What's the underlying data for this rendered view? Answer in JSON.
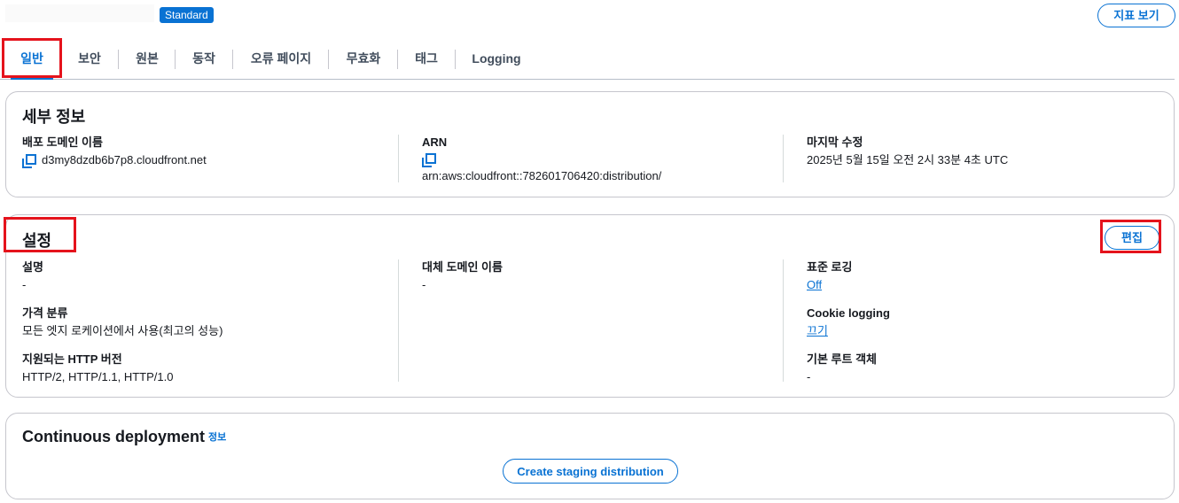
{
  "header": {
    "badge": "Standard",
    "metrics_button": "지표 보기"
  },
  "tabs": [
    {
      "label": "일반",
      "active": true
    },
    {
      "label": "보안",
      "active": false
    },
    {
      "label": "원본",
      "active": false
    },
    {
      "label": "동작",
      "active": false
    },
    {
      "label": "오류 페이지",
      "active": false
    },
    {
      "label": "무효화",
      "active": false
    },
    {
      "label": "태그",
      "active": false
    },
    {
      "label": "Logging",
      "active": false
    }
  ],
  "details": {
    "title": "세부 정보",
    "domain_label": "배포 도메인 이름",
    "domain_value": "d3my8dzdb6b7p8.cloudfront.net",
    "arn_label": "ARN",
    "arn_value": "arn:aws:cloudfront::782601706420:distribution/",
    "modified_label": "마지막 수정",
    "modified_value": "2025년 5월 15일 오전 2시 33분 4초 UTC"
  },
  "settings": {
    "title": "설정",
    "edit_button": "편집",
    "description_label": "설명",
    "description_value": "-",
    "price_class_label": "가격 분류",
    "price_class_value": "모든 엣지 로케이션에서 사용(최고의 성능)",
    "http_label": "지원되는 HTTP 버전",
    "http_value": "HTTP/2, HTTP/1.1, HTTP/1.0",
    "alt_domain_label": "대체 도메인 이름",
    "alt_domain_value": "-",
    "std_logging_label": "표준 로깅",
    "std_logging_value": "Off",
    "cookie_logging_label": "Cookie logging",
    "cookie_logging_value": "끄기",
    "root_object_label": "기본 루트 객체",
    "root_object_value": "-"
  },
  "continuous": {
    "title": "Continuous deployment",
    "info": "정보",
    "button": "Create staging distribution"
  },
  "colors": {
    "accent": "#0972d3",
    "highlight": "#e5131c"
  }
}
